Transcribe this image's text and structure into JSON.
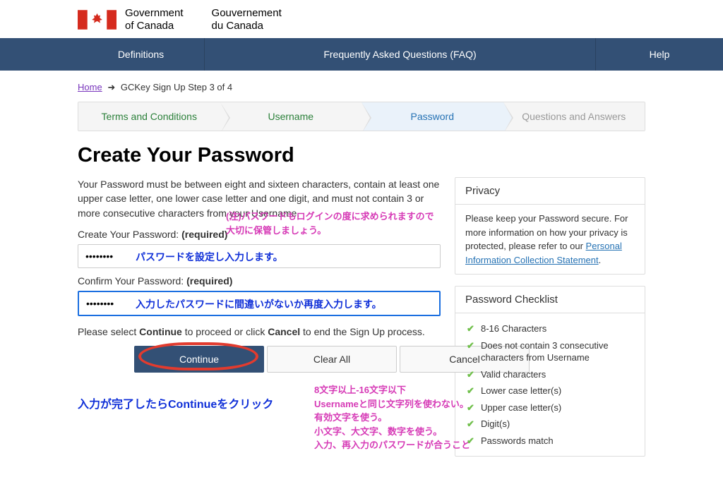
{
  "header": {
    "gov_en_line1": "Government",
    "gov_en_line2": "of Canada",
    "gov_fr_line1": "Gouvernement",
    "gov_fr_line2": "du Canada"
  },
  "nav": {
    "definitions": "Definitions",
    "faq": "Frequently Asked Questions (FAQ)",
    "help": "Help"
  },
  "crumbs": {
    "home": "Home",
    "current": "GCKey Sign Up Step 3 of 4"
  },
  "steps": {
    "s1": "Terms and Conditions",
    "s2": "Username",
    "s3": "Password",
    "s4": "Questions and Answers"
  },
  "title": "Create Your Password",
  "description": "Your Password must be between eight and sixteen characters, contain at least one upper case letter, one lower case letter and one digit, and must not contain 3 or more consecutive characters from your Username.",
  "fields": {
    "create_label": "Create Your Password:",
    "confirm_label": "Confirm Your Password:",
    "required": "(required)",
    "value": "••••••••"
  },
  "instruction": {
    "pre": "Please select ",
    "continue": "Continue",
    "mid": " to proceed or click ",
    "cancel": "Cancel",
    "post": " to end the Sign Up process."
  },
  "buttons": {
    "continue": "Continue",
    "clear": "Clear All",
    "cancel": "Cancel"
  },
  "privacy": {
    "title": "Privacy",
    "body_pre": "Please keep your Password secure. For more information on how your privacy is protected, please refer to our ",
    "link": "Personal Information Collection Statement",
    "body_post": "."
  },
  "checklist": {
    "title": "Password Checklist",
    "items": [
      "8-16 Characters",
      "Does not contain 3 consecutive characters from Username",
      "Valid characters",
      "Lower case letter(s)",
      "Upper case letter(s)",
      "Digit(s)",
      "Passwords match"
    ]
  },
  "annotations": {
    "note_top": "(注)パスワードもログインの度に求められますので\n大切に保管しましょう。",
    "in1": "パスワードを設定し入力します。",
    "in2": "入力したパスワードに間違いがないか再度入力します。",
    "cont": "入力が完了したらContinueをクリック",
    "rules": "8文字以上-16文字以下\nUsernameと同じ文字列を使わない。\n有効文字を使う。\n小文字、大文字、数字を使う。\n入力、再入力のパスワードが合うこと"
  }
}
